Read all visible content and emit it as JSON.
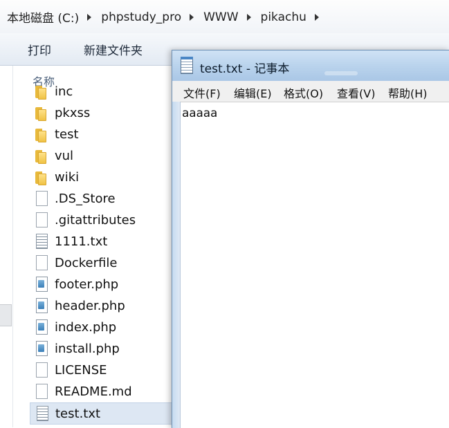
{
  "explorer": {
    "breadcrumb": [
      "本地磁盘 (C:)",
      "phpstudy_pro",
      "WWW",
      "pikachu"
    ],
    "toolbar": {
      "print_label": "打印",
      "new_folder_label": "新建文件夹"
    },
    "column_header": "名称",
    "files": [
      {
        "name": "inc",
        "type": "folder"
      },
      {
        "name": "pkxss",
        "type": "folder"
      },
      {
        "name": "test",
        "type": "folder"
      },
      {
        "name": "vul",
        "type": "folder"
      },
      {
        "name": "wiki",
        "type": "folder"
      },
      {
        "name": ".DS_Store",
        "type": "file"
      },
      {
        "name": ".gitattributes",
        "type": "file"
      },
      {
        "name": "1111.txt",
        "type": "text"
      },
      {
        "name": "Dockerfile",
        "type": "file"
      },
      {
        "name": "footer.php",
        "type": "php"
      },
      {
        "name": "header.php",
        "type": "php"
      },
      {
        "name": "index.php",
        "type": "php"
      },
      {
        "name": "install.php",
        "type": "php"
      },
      {
        "name": "LICENSE",
        "type": "file"
      },
      {
        "name": "README.md",
        "type": "file"
      },
      {
        "name": "test.txt",
        "type": "text",
        "selected": true
      }
    ]
  },
  "notepad": {
    "title": "test.txt - 记事本",
    "menu": [
      "文件(F)",
      "编辑(E)",
      "格式(O)",
      "查看(V)",
      "帮助(H)"
    ],
    "content": "aaaaa"
  }
}
